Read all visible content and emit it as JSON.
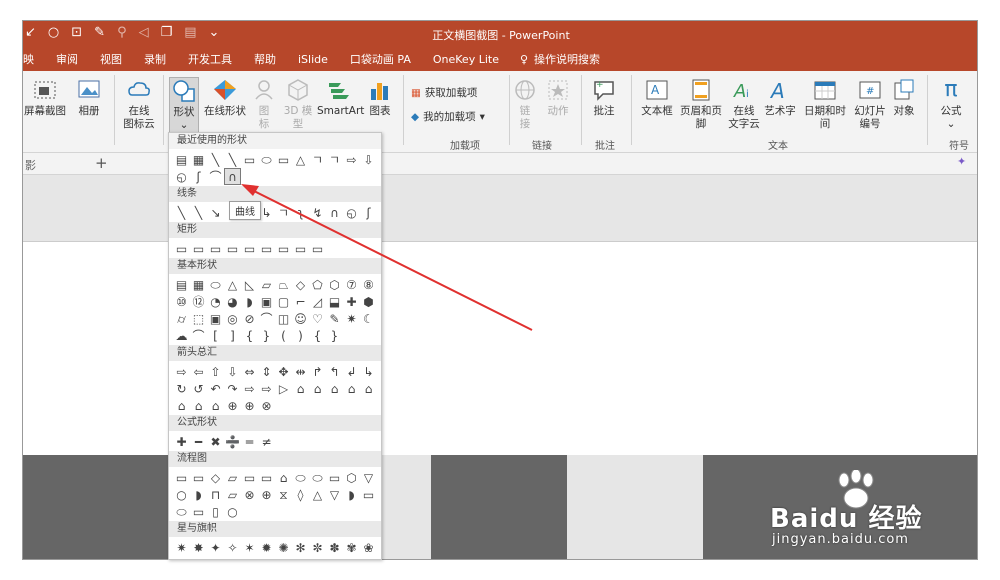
{
  "window": {
    "title": "正文横图截图 - PowerPoint"
  },
  "menu_tabs": [
    "映",
    "审阅",
    "视图",
    "录制",
    "开发工具",
    "帮助",
    "iSlide",
    "口袋动画 PA",
    "OneKey Lite"
  ],
  "tell_me": "操作说明搜索",
  "ribbon": {
    "screenshot": "屏幕截图",
    "album": "相册",
    "online_icons": [
      "在线",
      "图标云"
    ],
    "shapes": "形状",
    "online_shapes": "在线形状",
    "icons": [
      "图",
      "标"
    ],
    "model3d": [
      "3D 模",
      "型"
    ],
    "smartart": "SmartArt",
    "chart": "图表",
    "get_addins": "获取加载项",
    "my_addins": "我的加载项",
    "addins_group": "加载项",
    "link": [
      "链",
      "接"
    ],
    "action": "动作",
    "links_group": "链接",
    "comment": "批注",
    "comments_group": "批注",
    "textbox": "文本框",
    "header_footer": "页眉和页脚",
    "online_text": [
      "在线",
      "文字云"
    ],
    "wordart": "艺术字",
    "datetime": "日期和时间",
    "slide_number": [
      "幻灯片",
      "编号"
    ],
    "object": "对象",
    "text_group": "文本",
    "equation": "公式",
    "symbols_group": "符号"
  },
  "slidebar": {
    "left": "影",
    "plus": "+"
  },
  "shapes_panel": {
    "sections": [
      {
        "title": "最近使用的形状",
        "shapes": [
          "▤",
          "▦",
          "╲",
          "╲",
          "▭",
          "⬭",
          "▭",
          "△",
          "ㄱ",
          "ㄱ",
          "⇨",
          "⇩",
          "◵",
          "ʃ",
          "⌒",
          "∩"
        ]
      },
      {
        "title": "线条",
        "shapes": [
          "╲",
          "╲",
          "↘",
          "ㄱ",
          "ㄱ",
          "↳",
          "ㄱ",
          "ʅ",
          "↯",
          "∩",
          "◵",
          "ʃ"
        ]
      },
      {
        "title": "矩形",
        "shapes": [
          "▭",
          "▭",
          "▭",
          "▭",
          "▭",
          "▭",
          "▭",
          "▭",
          "▭"
        ]
      },
      {
        "title": "基本形状",
        "shapes": [
          "▤",
          "▦",
          "⬭",
          "△",
          "◺",
          "▱",
          "⏢",
          "◇",
          "⬠",
          "⬡",
          "⑦",
          "⑧",
          "⑩",
          "⑫",
          "◔",
          "◕",
          "◗",
          "▣",
          "▢",
          "⌐",
          "◿",
          "⬓",
          "✚",
          "⬢",
          "⌭",
          "⬚",
          "▣",
          "◎",
          "⊘",
          "⌒",
          "◫",
          "☺",
          "♡",
          "✎",
          "✷",
          "☾",
          "☁",
          "⌒",
          "[",
          "]",
          "{",
          "}",
          "(",
          ")",
          "{",
          "}"
        ]
      },
      {
        "title": "箭头总汇",
        "shapes": [
          "⇨",
          "⇦",
          "⇧",
          "⇩",
          "⇔",
          "⇕",
          "✥",
          "⇹",
          "↱",
          "↰",
          "↲",
          "↳",
          "↻",
          "↺",
          "↶",
          "↷",
          "⇨",
          "⇨",
          "▷",
          "⌂",
          "⌂",
          "⌂",
          "⌂",
          "⌂",
          "⌂",
          "⌂",
          "⌂",
          "⊕",
          "⊕",
          "⊗"
        ]
      },
      {
        "title": "公式形状",
        "shapes": [
          "✚",
          "━",
          "✖",
          "➗",
          "═",
          "≠"
        ]
      },
      {
        "title": "流程图",
        "shapes": [
          "▭",
          "▭",
          "◇",
          "▱",
          "▭",
          "▭",
          "⌂",
          "⬭",
          "⬭",
          "▭",
          "⬡",
          "▽",
          "○",
          "◗",
          "⊓",
          "▱",
          "⊗",
          "⊕",
          "⧖",
          "◊",
          "△",
          "▽",
          "◗",
          "▭",
          "⬭",
          "▭",
          "▯",
          "○"
        ]
      },
      {
        "title": "星与旗帜",
        "shapes": [
          "✷",
          "✸",
          "✦",
          "✧",
          "✶",
          "✹",
          "✺",
          "✻",
          "✼",
          "✽",
          "✾",
          "❀",
          "⚑",
          "⚐",
          "⚑",
          "⚐",
          "⚑",
          "⚐"
        ]
      }
    ]
  },
  "tooltip": "曲线",
  "watermark": {
    "main": "Baidu 经验",
    "sub": "jingyan.baidu.com"
  },
  "colors": {
    "accent": "#b7472a",
    "arrow": "#e0302f"
  },
  "icons": [
    "qat-circle-icon",
    "screenshot-icon",
    "album-icon",
    "online-icons-icon",
    "shapes-icon",
    "online-shapes-icon",
    "icons-icon",
    "3d-model-icon",
    "smartart-icon",
    "chart-icon",
    "get-addins-icon",
    "my-addins-icon",
    "link-icon",
    "action-icon",
    "comment-icon",
    "textbox-icon",
    "header-footer-icon",
    "online-text-icon",
    "wordart-icon",
    "datetime-icon",
    "slide-number-icon",
    "object-icon",
    "equation-icon",
    "lightbulb-icon"
  ]
}
